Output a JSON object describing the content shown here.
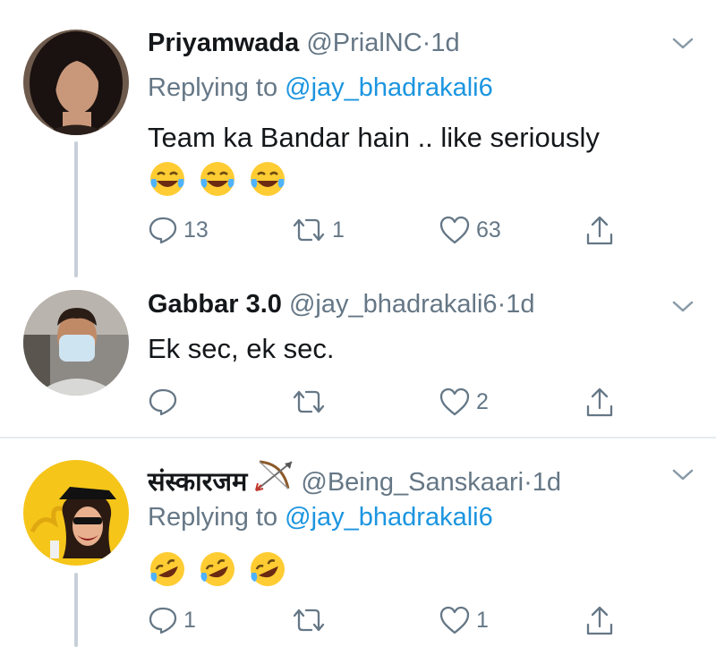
{
  "tweets": [
    {
      "name": "Priyamwada",
      "handle": "@PrialNC",
      "separator": "·",
      "time": "1d",
      "replying_prefix": "Replying to",
      "replying_handle": "@jay_bhadrakali6",
      "text": "Team ka Bandar hain .. like seriously",
      "emojis": [
        "joy-face",
        "joy-face",
        "joy-face"
      ],
      "replies": "13",
      "retweets": "1",
      "likes": "63"
    },
    {
      "name": "Gabbar 3.0",
      "handle": "@jay_bhadrakali6",
      "separator": "·",
      "time": "1d",
      "text": "Ek sec, ek sec.",
      "replies": "",
      "retweets": "",
      "likes": "2"
    },
    {
      "name": "संस्कारजम",
      "name_emoji": "bow-and-arrow",
      "handle": "@Being_Sanskaari",
      "separator": "·",
      "time": "1d",
      "replying_prefix": "Replying to",
      "replying_handle": "@jay_bhadrakali6",
      "emojis": [
        "rofl-face",
        "rofl-face",
        "rofl-face"
      ],
      "replies": "1",
      "retweets": "",
      "likes": "1"
    }
  ],
  "colors": {
    "text": "#14171a",
    "secondary": "#657786",
    "link": "#1b95e0",
    "thread_line": "#c7d0d8",
    "divider": "#e6ecf0"
  }
}
